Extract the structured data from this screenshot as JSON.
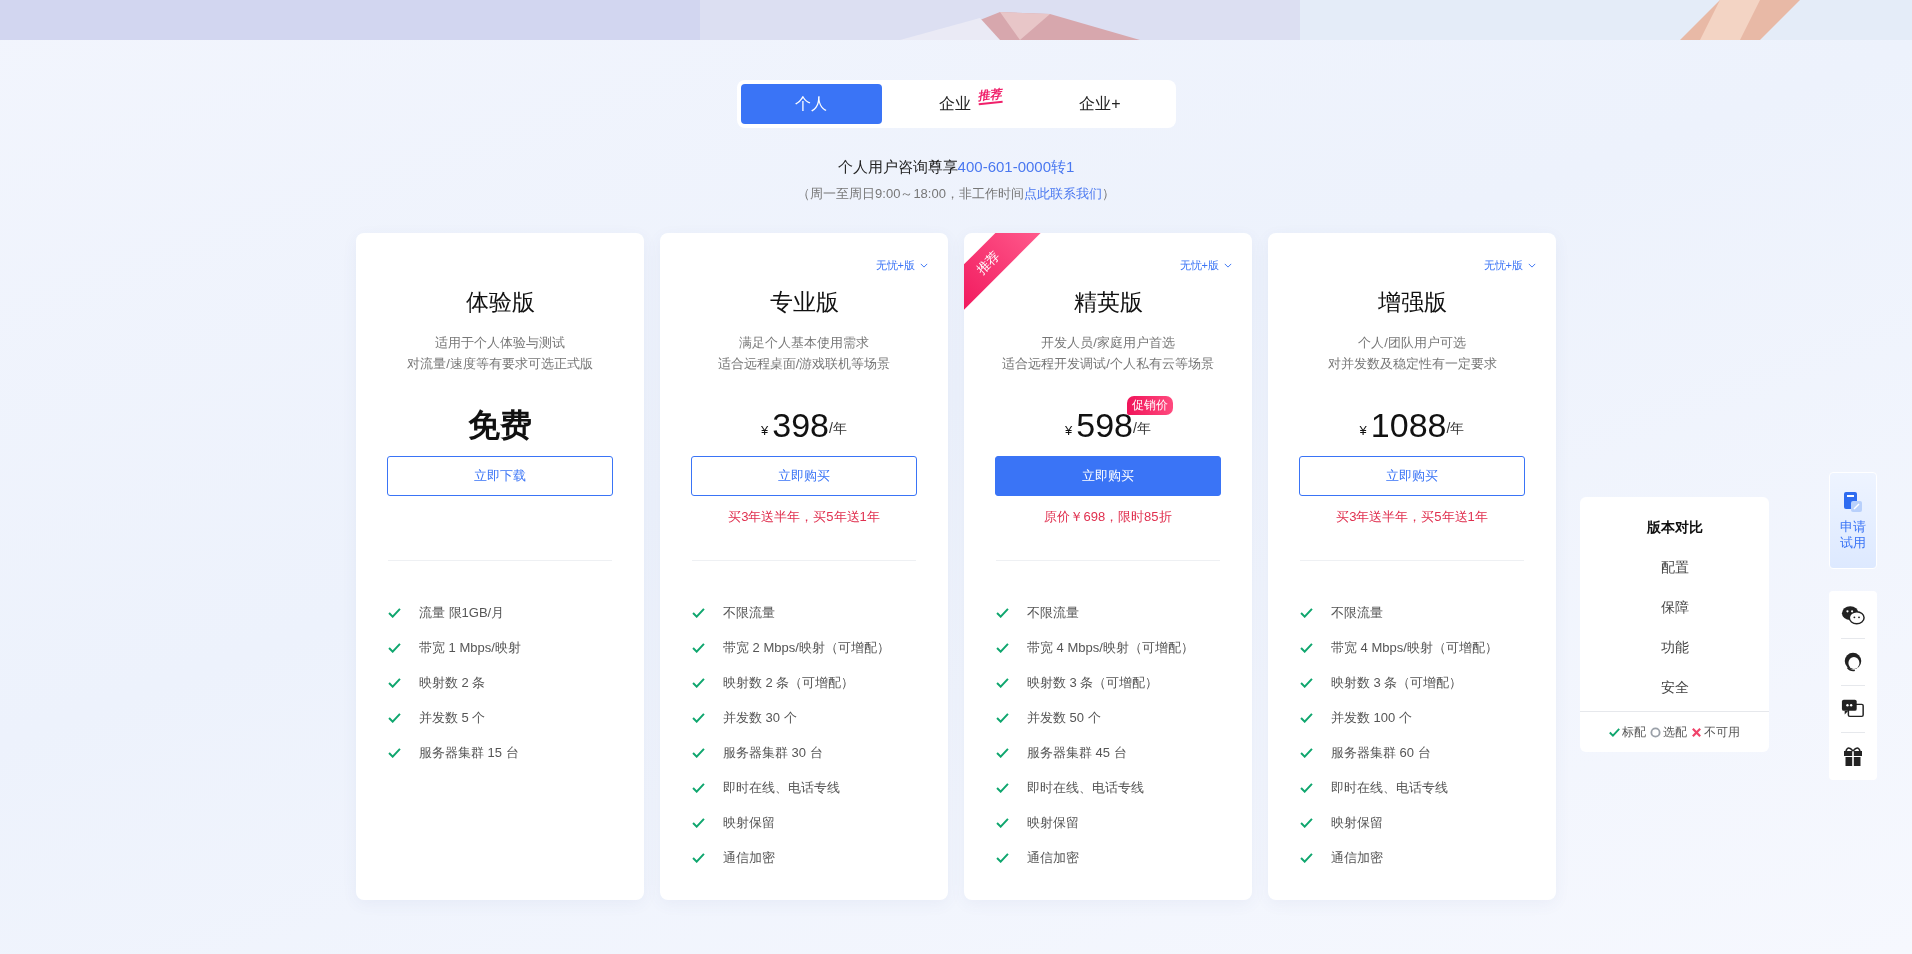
{
  "tabs": [
    {
      "label": "个人",
      "selected": true
    },
    {
      "label": "企业",
      "selected": false,
      "badge": "推荐"
    },
    {
      "label": "企业+",
      "selected": false
    }
  ],
  "consult": {
    "text": "个人用户咨询尊享",
    "phone": "400-601-0000转1",
    "hours": "（周一至周日9:00～18:00，非工作时间",
    "link": "点此联系我们",
    "hours_end": "）"
  },
  "plans": [
    {
      "name": "体验版",
      "desc": [
        "适用于个人体验与测试",
        "对流量/速度等有要求可选正式版"
      ],
      "price": {
        "kind": "free",
        "amount": "免费"
      },
      "button": {
        "label": "立即下载",
        "primary": false
      },
      "features": [
        "流量 限1GB/月",
        "带宽 1 Mbps/映射",
        "映射数 2 条",
        "并发数 5 个",
        "服务器集群 15 台"
      ]
    },
    {
      "name": "专业版",
      "variant": "无忧+版",
      "desc": [
        "满足个人基本使用需求",
        "适合远程桌面/游戏联机等场景"
      ],
      "price": {
        "kind": "paid",
        "currency": "¥",
        "amount": "398",
        "period": "/年"
      },
      "button": {
        "label": "立即购买",
        "primary": false
      },
      "promo": "买3年送半年，买5年送1年",
      "features": [
        "不限流量",
        "带宽 2 Mbps/映射（可增配）",
        "映射数 2 条（可增配）",
        "并发数 30 个",
        "服务器集群 30 台",
        "即时在线、电话专线",
        "映射保留",
        "通信加密"
      ]
    },
    {
      "name": "精英版",
      "variant": "无忧+版",
      "ribbon": "推荐",
      "desc": [
        "开发人员/家庭用户首选",
        "适合远程开发调试/个人私有云等场景"
      ],
      "price": {
        "kind": "paid",
        "currency": "¥",
        "amount": "598",
        "period": "/年",
        "badge": "促销价"
      },
      "button": {
        "label": "立即购买",
        "primary": true
      },
      "promo": "原价￥698，限时85折",
      "features": [
        "不限流量",
        "带宽 4 Mbps/映射（可增配）",
        "映射数 3 条（可增配）",
        "并发数 50 个",
        "服务器集群 45 台",
        "即时在线、电话专线",
        "映射保留",
        "通信加密"
      ]
    },
    {
      "name": "增强版",
      "variant": "无忧+版",
      "desc": [
        "个人/团队用户可选",
        "对并发数及稳定性有一定要求"
      ],
      "price": {
        "kind": "paid",
        "currency": "¥",
        "amount": "1088",
        "period": "/年"
      },
      "button": {
        "label": "立即购买",
        "primary": false
      },
      "promo": "买3年送半年，买5年送1年",
      "features": [
        "不限流量",
        "带宽 4 Mbps/映射（可增配）",
        "映射数 3 条（可增配）",
        "并发数 100 个",
        "服务器集群 60 台",
        "即时在线、电话专线",
        "映射保留",
        "通信加密"
      ]
    }
  ],
  "compare": {
    "title": "版本对比",
    "items": [
      "配置",
      "保障",
      "功能",
      "安全"
    ],
    "legend": [
      {
        "kind": "standard",
        "label": "标配"
      },
      {
        "kind": "optional",
        "label": "选配"
      },
      {
        "kind": "unavailable",
        "label": "不可用"
      }
    ]
  },
  "float_bar": {
    "trial": "申请试用"
  }
}
